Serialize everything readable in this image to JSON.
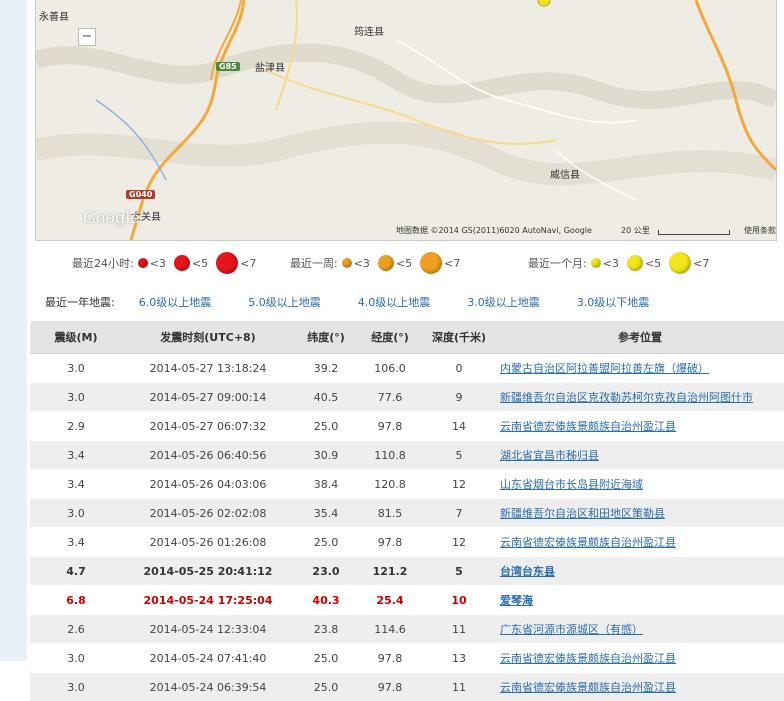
{
  "map": {
    "labels": {
      "yongshan": "永善县",
      "yunlian": "筠连县",
      "yanjin": "盐津县",
      "weixin": "威信县",
      "daguan": "大关县"
    },
    "highways": {
      "g85": "G85",
      "g040": "G040"
    },
    "zoom_out": "−",
    "google": "Google",
    "attribution": "地图数据 ©2014 GS(2011)6020 AutoNavi, Google",
    "scale": "20 公里",
    "terms": "使用条款"
  },
  "legend": {
    "day_label": "最近24小时:",
    "week_label": "最近一周:",
    "month_label": "最近一个月:",
    "lt3": "<3",
    "lt5": "<5",
    "lt7": "<7",
    "colors": {
      "day": "#e8141b",
      "week": "#f0a020",
      "month": "#f2e61a"
    }
  },
  "filters": {
    "label": "最近一年地震:",
    "links": [
      "6.0级以上地震",
      "5.0级以上地震",
      "4.0级以上地震",
      "3.0级以上地震",
      "3.0级以下地震"
    ]
  },
  "table": {
    "headers": [
      "震级(M)",
      "发震时刻(UTC+8)",
      "纬度(°)",
      "经度(°)",
      "深度(千米)",
      "参考位置"
    ],
    "rows": [
      [
        "3.0",
        "2014-05-27 13:18:24",
        "39.2",
        "106.0",
        "0",
        "内蒙古自治区阿拉善盟阿拉善左旗（爆破）"
      ],
      [
        "3.0",
        "2014-05-27 09:00:14",
        "40.5",
        "77.6",
        "9",
        "新疆维吾尔自治区克孜勒苏柯尔克孜自治州阿图什市"
      ],
      [
        "2.9",
        "2014-05-27 06:07:32",
        "25.0",
        "97.8",
        "14",
        "云南省德宏傣族景颇族自治州盈江县"
      ],
      [
        "3.4",
        "2014-05-26 06:40:56",
        "30.9",
        "110.8",
        "5",
        "湖北省宜昌市秭归县"
      ],
      [
        "3.4",
        "2014-05-26 04:03:06",
        "38.4",
        "120.8",
        "12",
        "山东省烟台市长岛县附近海域"
      ],
      [
        "3.0",
        "2014-05-26 02:02:08",
        "35.4",
        "81.5",
        "7",
        "新疆维吾尔自治区和田地区策勒县"
      ],
      [
        "3.4",
        "2014-05-26 01:26:08",
        "25.0",
        "97.8",
        "12",
        "云南省德宏傣族景颇族自治州盈江县"
      ],
      [
        "4.7",
        "2014-05-25 20:41:12",
        "23.0",
        "121.2",
        "5",
        "台湾台东县"
      ],
      [
        "6.8",
        "2014-05-24 17:25:04",
        "40.3",
        "25.4",
        "10",
        "爱琴海"
      ],
      [
        "2.6",
        "2014-05-24 12:33:04",
        "23.8",
        "114.6",
        "11",
        "广东省河源市源城区（有感）"
      ],
      [
        "3.0",
        "2014-05-24 07:41:40",
        "25.0",
        "97.8",
        "13",
        "云南省德宏傣族景颇族自治州盈江县"
      ],
      [
        "3.0",
        "2014-05-24 06:39:54",
        "25.0",
        "97.8",
        "11",
        "云南省德宏傣族景颇族自治州盈江县"
      ]
    ]
  }
}
